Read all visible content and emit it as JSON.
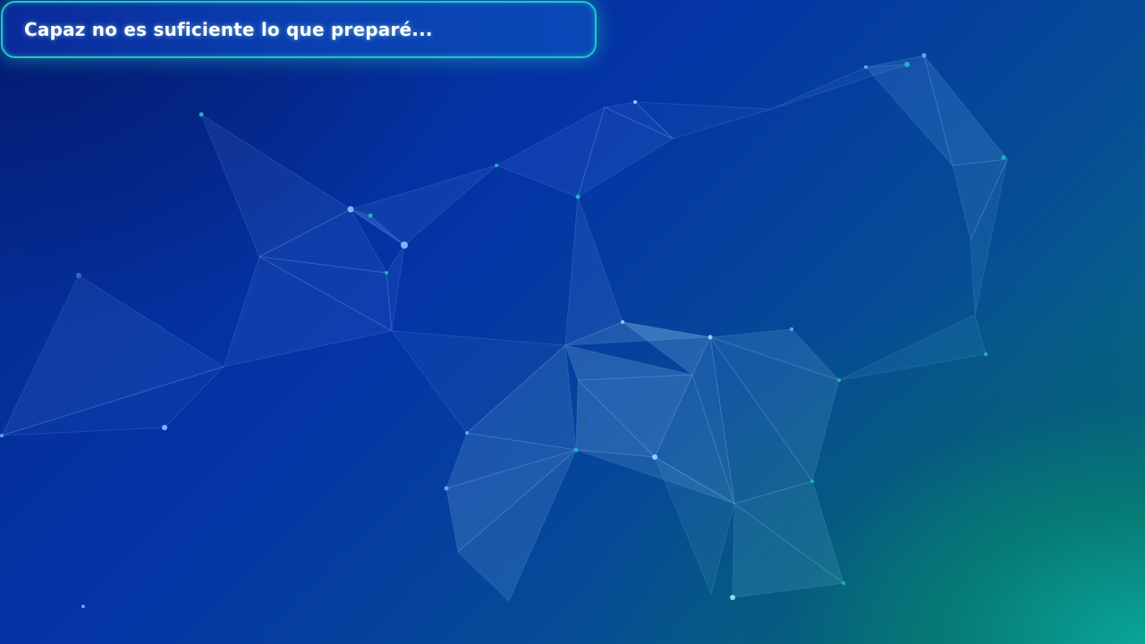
{
  "dialog": {
    "text": "Capaz no es suficiente lo que preparé..."
  },
  "background": {
    "description_icon": "polygon-network-background",
    "colors": {
      "deep_blue": "#041a6e",
      "mid_blue": "#0434a6",
      "teal": "#0aa59a",
      "border_accent": "#1fc7c2"
    }
  }
}
